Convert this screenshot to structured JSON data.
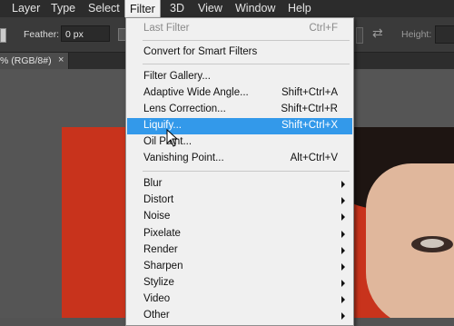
{
  "menubar": {
    "items": [
      "Layer",
      "Type",
      "Select",
      "Filter",
      "3D",
      "View",
      "Window",
      "Help"
    ]
  },
  "options": {
    "feather_label": "Feather:",
    "feather_value": "0 px",
    "height_label": "Height:"
  },
  "doc_tab": {
    "title": "% (RGB/8#)",
    "close": "×"
  },
  "filter_menu": {
    "last_filter": {
      "label": "Last Filter",
      "shortcut": "Ctrl+F"
    },
    "convert": {
      "label": "Convert for Smart Filters"
    },
    "gallery": {
      "label": "Filter Gallery..."
    },
    "adaptive": {
      "label": "Adaptive Wide Angle...",
      "shortcut": "Shift+Ctrl+A"
    },
    "lens": {
      "label": "Lens Correction...",
      "shortcut": "Shift+Ctrl+R"
    },
    "liquify": {
      "label": "Liquify...",
      "shortcut": "Shift+Ctrl+X"
    },
    "oil": {
      "label": "Oil Paint..."
    },
    "vanishing": {
      "label": "Vanishing Point...",
      "shortcut": "Alt+Ctrl+V"
    },
    "submenus": [
      "Blur",
      "Distort",
      "Noise",
      "Pixelate",
      "Render",
      "Sharpen",
      "Stylize",
      "Video",
      "Other"
    ]
  },
  "colors": {
    "highlight": "#3399ea",
    "canvas_background": "#c8331c"
  }
}
